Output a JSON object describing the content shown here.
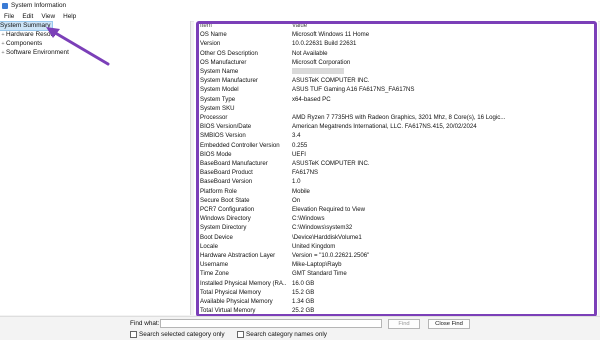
{
  "window": {
    "title": "System Information"
  },
  "menu": [
    "File",
    "Edit",
    "View",
    "Help"
  ],
  "tree": {
    "items": [
      {
        "label": "System Summary",
        "selected": true,
        "expander": ""
      },
      {
        "label": "Hardware Resources",
        "expander": "+"
      },
      {
        "label": "Components",
        "expander": "+"
      },
      {
        "label": "Software Environment",
        "expander": "+"
      }
    ]
  },
  "table": {
    "headers": [
      "Item",
      "Value"
    ],
    "rows": [
      [
        "OS Name",
        "Microsoft Windows 11 Home"
      ],
      [
        "Version",
        "10.0.22631 Build 22631"
      ],
      [
        "Other OS Description",
        "Not Available"
      ],
      [
        "OS Manufacturer",
        "Microsoft Corporation"
      ],
      [
        "System Name",
        ""
      ],
      [
        "System Manufacturer",
        "ASUSTeK COMPUTER INC."
      ],
      [
        "System Model",
        "ASUS TUF Gaming A16 FA617NS_FA617NS"
      ],
      [
        "System Type",
        "x64-based PC"
      ],
      [
        "System SKU",
        ""
      ],
      [
        "Processor",
        "AMD Ryzen 7 7735HS with Radeon Graphics, 3201 Mhz, 8 Core(s), 16 Logic..."
      ],
      [
        "BIOS Version/Date",
        "American Megatrends International, LLC. FA617NS.415, 20/02/2024"
      ],
      [
        "SMBIOS Version",
        "3.4"
      ],
      [
        "Embedded Controller Version",
        "0.255"
      ],
      [
        "BIOS Mode",
        "UEFI"
      ],
      [
        "BaseBoard Manufacturer",
        "ASUSTeK COMPUTER INC."
      ],
      [
        "BaseBoard Product",
        "FA617NS"
      ],
      [
        "BaseBoard Version",
        "1.0"
      ],
      [
        "Platform Role",
        "Mobile"
      ],
      [
        "Secure Boot State",
        "On"
      ],
      [
        "PCR7 Configuration",
        "Elevation Required to View"
      ],
      [
        "Windows Directory",
        "C:\\Windows"
      ],
      [
        "System Directory",
        "C:\\Windows\\system32"
      ],
      [
        "Boot Device",
        "\\Device\\HarddiskVolume1"
      ],
      [
        "Locale",
        "United Kingdom"
      ],
      [
        "Hardware Abstraction Layer",
        "Version = \"10.0.22621.2506\""
      ],
      [
        "Username",
        "Mike-Laptop\\Rayb"
      ],
      [
        "Time Zone",
        "GMT Standard Time"
      ],
      [
        "Installed Physical Memory (RA...",
        "16.0 GB"
      ],
      [
        "Total Physical Memory",
        "15.2 GB"
      ],
      [
        "Available Physical Memory",
        "1.34 GB"
      ],
      [
        "Total Virtual Memory",
        "25.2 GB"
      ]
    ]
  },
  "find": {
    "label": "Find what:",
    "value": "",
    "find_button": "Find",
    "close_button": "Close Find",
    "opt_selected": "Search selected category only",
    "opt_names": "Search category names only"
  },
  "colors": {
    "highlight": "#7b3fb8",
    "selection": "#cce4f7"
  }
}
